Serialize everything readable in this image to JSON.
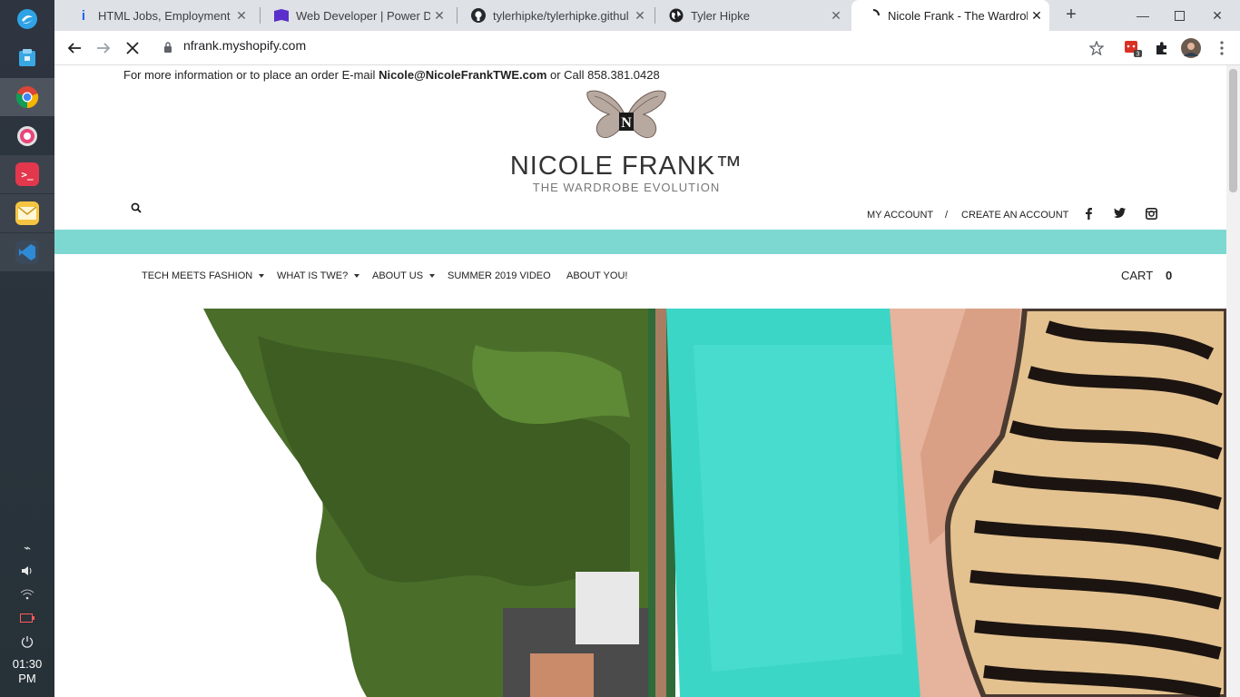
{
  "dock": {
    "apps": [
      "launcher-icon",
      "files-icon",
      "chrome-icon",
      "settings-icon",
      "terminal-icon",
      "mail-icon",
      "vscode-icon"
    ],
    "clock_time": "01:30",
    "clock_ampm": "PM"
  },
  "browser": {
    "tabs": [
      {
        "title": "HTML Jobs, Employment in",
        "icon": "indeed-icon"
      },
      {
        "title": "Web Developer | Power Dig",
        "icon": "power-digital-icon"
      },
      {
        "title": "tylerhipke/tylerhipke.githul",
        "icon": "github-icon"
      },
      {
        "title": "Tyler Hipke",
        "icon": "globe-icon"
      },
      {
        "title": "Nicole Frank - The Wardrob",
        "icon": "loading-icon"
      }
    ],
    "url": "nfrank.myshopify.com",
    "extension_badge": "3"
  },
  "page": {
    "info_prefix": "For more information or to place an order E-mail ",
    "info_email": "Nicole@NicoleFrankTWE.com",
    "info_suffix": " or Call 858.381.0428",
    "brand_name": "NICOLE FRANK™",
    "brand_tagline": "THE WARDROBE EVOLUTION",
    "my_account": "MY ACCOUNT",
    "separator": "/",
    "create_account": "CREATE AN ACCOUNT",
    "nav": {
      "tech_meets_fashion": "TECH MEETS FASHION",
      "what_is_twe": "WHAT IS TWE?",
      "about_us": "ABOUT US",
      "summer_video": "SUMMER 2019 VIDEO",
      "about_you": "ABOUT YOU!"
    },
    "cart_label": "CART",
    "cart_count": "0",
    "accent_color": "#7dd8d2"
  }
}
